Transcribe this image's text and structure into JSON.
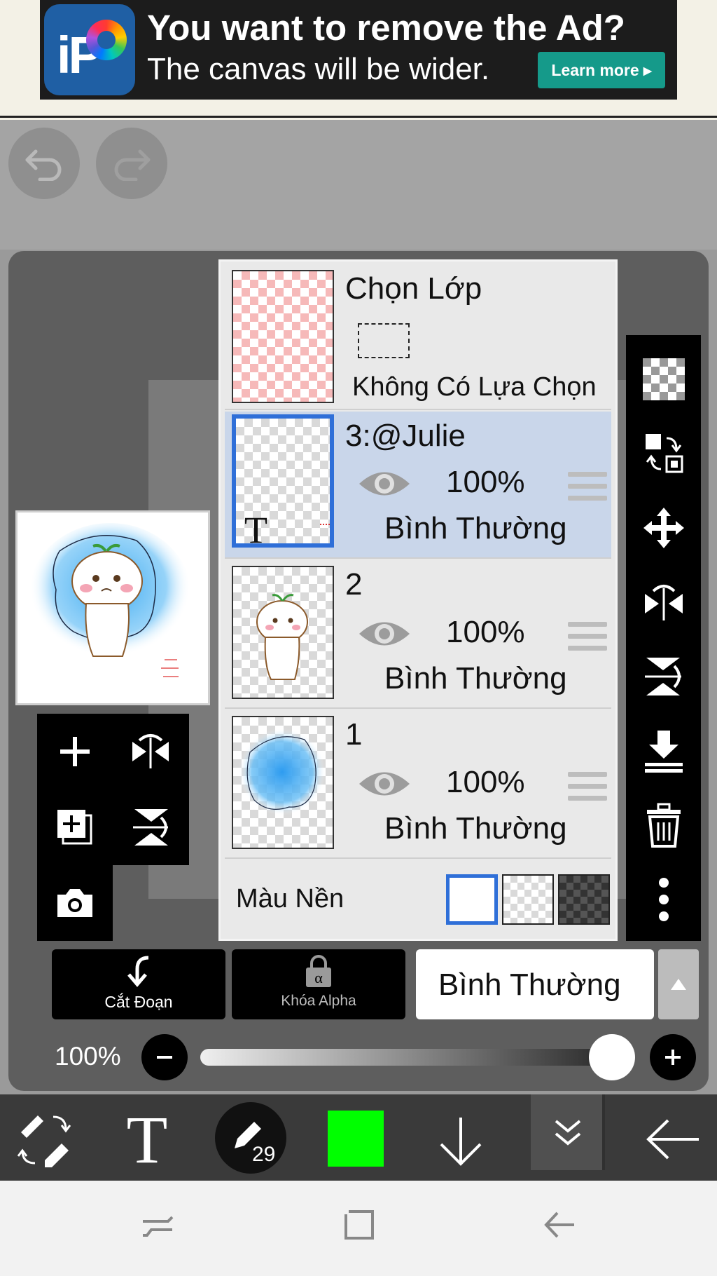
{
  "ad": {
    "title": "You want to remove the Ad?",
    "subtitle": "The canvas will be wider.",
    "learn_more": "Learn more ▸",
    "logo_text": "iP"
  },
  "icons": {
    "undo": "undo-icon",
    "redo": "redo-icon"
  },
  "layers_panel": {
    "selection": {
      "title": "Chọn Lớp",
      "status": "Không Có Lựa Chọn"
    },
    "layers": [
      {
        "name": "3:@Julie",
        "opacity": "100%",
        "blend": "Bình Thường",
        "selected": true
      },
      {
        "name": "2",
        "opacity": "100%",
        "blend": "Bình Thường",
        "selected": false
      },
      {
        "name": "1",
        "opacity": "100%",
        "blend": "Bình Thường",
        "selected": false
      }
    ],
    "background": {
      "label": "Màu Nền",
      "options": [
        "white",
        "transparent",
        "dark"
      ],
      "selected": "white"
    }
  },
  "options": {
    "clipping_label": "Cắt Đoạn",
    "alpha_lock_label": "Khóa Alpha",
    "blend_mode": "Bình Thường"
  },
  "opacity": {
    "label": "100%",
    "value": 1.0
  },
  "toolbar": {
    "brush_size": "29",
    "current_color": "#00ff00"
  },
  "colors": {
    "selection_blue": "#2f6fd8",
    "selected_row": "#c9d6ea",
    "ad_button": "#159a8a"
  }
}
